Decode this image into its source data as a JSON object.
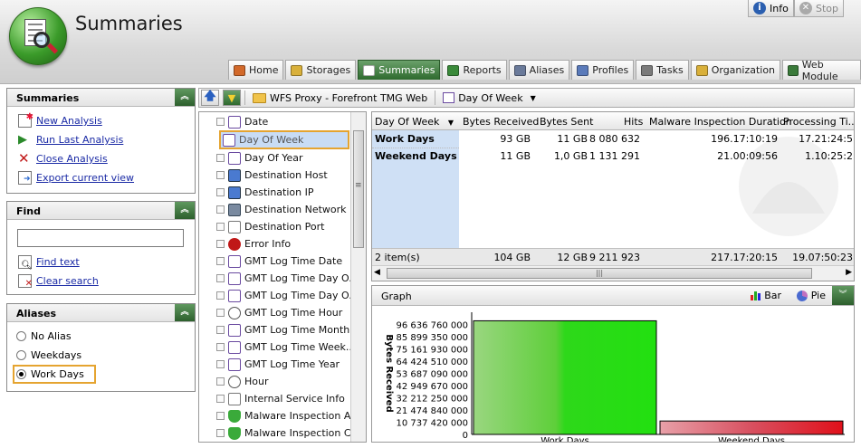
{
  "app": {
    "title": "Summaries"
  },
  "top_buttons": {
    "info": "Info",
    "stop": "Stop"
  },
  "tabs": [
    {
      "label": "Home",
      "icon": "home-icon",
      "color": "#d2692a"
    },
    {
      "label": "Storages",
      "icon": "storage-icon",
      "color": "#d9b03a"
    },
    {
      "label": "Summaries",
      "icon": "summaries-icon",
      "color": "#ffffff",
      "active": true
    },
    {
      "label": "Reports",
      "icon": "reports-icon",
      "color": "#3a8a3a"
    },
    {
      "label": "Aliases",
      "icon": "aliases-icon",
      "color": "#6a7a9a"
    },
    {
      "label": "Profiles",
      "icon": "profiles-icon",
      "color": "#5a7aba"
    },
    {
      "label": "Tasks",
      "icon": "tasks-icon",
      "color": "#7a7a7a"
    },
    {
      "label": "Organization",
      "icon": "organization-icon",
      "color": "#d9b03a"
    },
    {
      "label": "Web Module",
      "icon": "globe-icon",
      "color": "#3a7a3a"
    }
  ],
  "summaries_panel": {
    "title": "Summaries",
    "actions": [
      {
        "label": "New Analysis",
        "icon": "new-analysis-icon"
      },
      {
        "label": "Run Last Analysis",
        "icon": "run-icon"
      },
      {
        "label": "Close Analysis",
        "icon": "close-icon"
      },
      {
        "label": "Export current view",
        "icon": "export-icon"
      }
    ]
  },
  "find_panel": {
    "title": "Find",
    "search_value": "",
    "find_text": "Find text",
    "clear_search": "Clear search"
  },
  "aliases_panel": {
    "title": "Aliases",
    "options": [
      {
        "label": "No Alias",
        "selected": false
      },
      {
        "label": "Weekdays",
        "selected": false
      },
      {
        "label": "Work Days",
        "selected": true
      }
    ]
  },
  "toolbar": {
    "breadcrumb_source": "WFS Proxy - Forefront TMG Web",
    "breadcrumb_field": "Day Of Week"
  },
  "field_list": [
    {
      "label": "Date",
      "icon": "calendar-icon"
    },
    {
      "label": "Day Of Week",
      "icon": "calendar-icon",
      "selected": true
    },
    {
      "label": "Day Of Year",
      "icon": "calendar-icon"
    },
    {
      "label": "Destination Host",
      "icon": "host-icon"
    },
    {
      "label": "Destination IP",
      "icon": "ip-icon"
    },
    {
      "label": "Destination Network",
      "icon": "network-icon"
    },
    {
      "label": "Destination Port",
      "icon": "port-icon"
    },
    {
      "label": "Error Info",
      "icon": "error-icon"
    },
    {
      "label": "GMT Log Time Date",
      "icon": "calendar-icon"
    },
    {
      "label": "GMT Log Time Day O...",
      "icon": "calendar-icon"
    },
    {
      "label": "GMT Log Time Day O...",
      "icon": "calendar-icon"
    },
    {
      "label": "GMT Log Time Hour",
      "icon": "clock-icon"
    },
    {
      "label": "GMT Log Time Month",
      "icon": "calendar-icon"
    },
    {
      "label": "GMT Log Time Week...",
      "icon": "calendar-icon"
    },
    {
      "label": "GMT Log Time Year",
      "icon": "calendar-icon"
    },
    {
      "label": "Hour",
      "icon": "clock-icon"
    },
    {
      "label": "Internal Service Info",
      "icon": "info-doc-icon"
    },
    {
      "label": "Malware Inspection A...",
      "icon": "shield-icon"
    },
    {
      "label": "Malware Inspection C...",
      "icon": "shield-icon"
    }
  ],
  "grid": {
    "columns": [
      "Day Of Week",
      "Bytes Received",
      "Bytes Sent",
      "Hits",
      "Malware Inspection Duration",
      "Processing Ti..."
    ],
    "rows": [
      [
        "Work Days",
        "93 GB",
        "11 GB",
        "8 080 632",
        "196.17:10:19",
        "17.21:24:5"
      ],
      [
        "Weekend Days",
        "11 GB",
        "1,0 GB",
        "1 131 291",
        "21.00:09:56",
        "1.10:25:2"
      ]
    ],
    "footer": [
      "2 item(s)",
      "104 GB",
      "12 GB",
      "9 211 923",
      "217.17:20:15",
      "19.07:50:23"
    ]
  },
  "graph": {
    "title": "Graph",
    "bar_label": "Bar",
    "pie_label": "Pie"
  },
  "chart_data": {
    "type": "bar",
    "categories": [
      "Work Days",
      "Weekend Days"
    ],
    "values": [
      99857000000,
      11800000000
    ],
    "ylabel": "Bytes Received",
    "yticks": [
      "96 636 760 000",
      "85 899 350 000",
      "75 161 930 000",
      "64 424 510 000",
      "53 687 090 000",
      "42 949 670 000",
      "32 212 250 000",
      "21 474 840 000",
      "10 737 420 000",
      "0"
    ],
    "ylim": [
      0,
      107374182400
    ],
    "colors": [
      "#4fd82a",
      "#e0202a"
    ]
  }
}
